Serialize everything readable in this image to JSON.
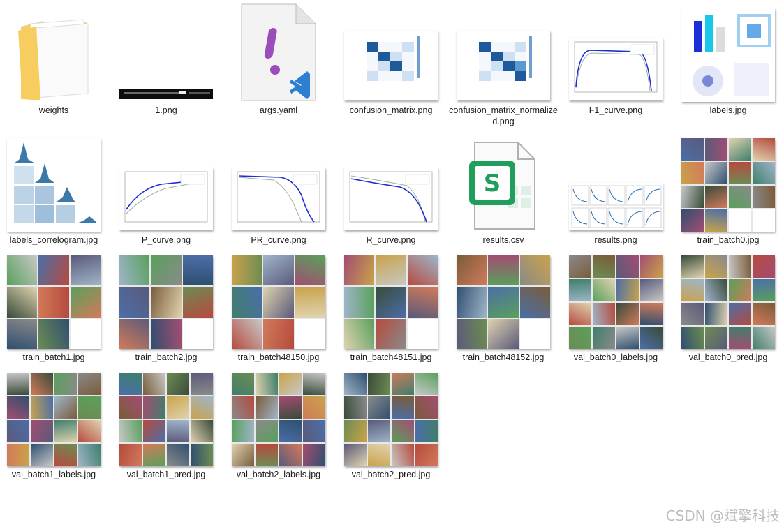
{
  "files": [
    {
      "name": "weights",
      "kind": "folder"
    },
    {
      "name": "1.png",
      "kind": "terminal"
    },
    {
      "name": "args.yaml",
      "kind": "yaml"
    },
    {
      "name": "confusion_matrix.png",
      "kind": "matrix"
    },
    {
      "name": "confusion_matrix_normalized.png",
      "kind": "matrix"
    },
    {
      "name": "F1_curve.png",
      "kind": "curve"
    },
    {
      "name": "labels.jpg",
      "kind": "labels"
    },
    {
      "name": "labels_correlogram.jpg",
      "kind": "correlogram"
    },
    {
      "name": "P_curve.png",
      "kind": "curve"
    },
    {
      "name": "PR_curve.png",
      "kind": "curve"
    },
    {
      "name": "R_curve.png",
      "kind": "curve"
    },
    {
      "name": "results.csv",
      "kind": "csv"
    },
    {
      "name": "results.png",
      "kind": "results"
    },
    {
      "name": "train_batch0.jpg",
      "kind": "photos"
    },
    {
      "name": "train_batch1.jpg",
      "kind": "photos"
    },
    {
      "name": "train_batch2.jpg",
      "kind": "photos"
    },
    {
      "name": "train_batch48150.jpg",
      "kind": "photos"
    },
    {
      "name": "train_batch48151.jpg",
      "kind": "photos"
    },
    {
      "name": "train_batch48152.jpg",
      "kind": "photos"
    },
    {
      "name": "val_batch0_labels.jpg",
      "kind": "photos"
    },
    {
      "name": "val_batch0_pred.jpg",
      "kind": "photos"
    },
    {
      "name": "val_batch1_labels.jpg",
      "kind": "photos"
    },
    {
      "name": "val_batch1_pred.jpg",
      "kind": "photos"
    },
    {
      "name": "val_batch2_labels.jpg",
      "kind": "photos"
    },
    {
      "name": "val_batch2_pred.jpg",
      "kind": "photos"
    }
  ],
  "watermark": "CSDN @斌擎科技",
  "colors": {
    "folder": "#f5c451",
    "vscode": "#2d7fd2",
    "csv": "#1f9e5c",
    "exclaim": "#9b4dbb"
  }
}
